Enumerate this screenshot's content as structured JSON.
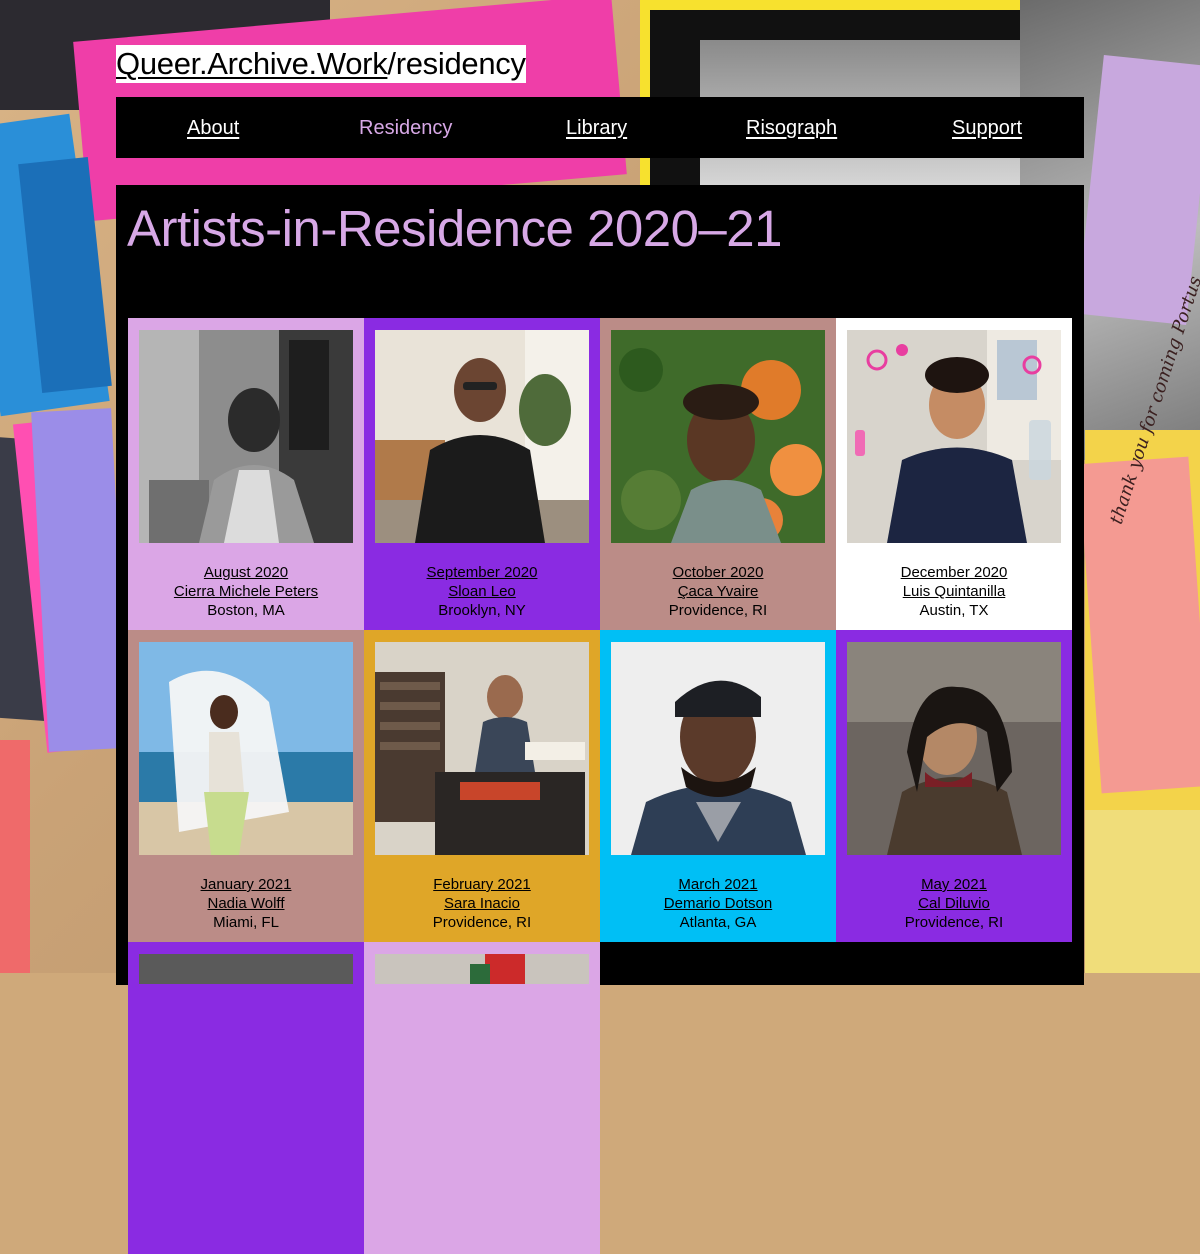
{
  "site": {
    "title_link": "Queer.Archive.Work",
    "title_path": "/residency"
  },
  "nav": {
    "items": [
      {
        "label": "About",
        "active": false
      },
      {
        "label": "Residency",
        "active": true
      },
      {
        "label": "Library",
        "active": false
      },
      {
        "label": "Risograph",
        "active": false
      },
      {
        "label": "Support",
        "active": false
      }
    ]
  },
  "page": {
    "heading": "Artists-in-Residence 2020–21"
  },
  "handwriting": "thank you for coming Portus",
  "residents": [
    {
      "month": "August 2020",
      "name": "Cierra Michele Peters",
      "location": "Boston, MA",
      "color": "#dba6e6"
    },
    {
      "month": "September 2020",
      "name": "Sloan Leo",
      "location": "Brooklyn, NY",
      "color": "#8a2be2"
    },
    {
      "month": "October 2020",
      "name": "Çaca Yvaire",
      "location": "Providence, RI",
      "color": "#bb8c87"
    },
    {
      "month": "December 2020",
      "name": "Luis Quintanilla",
      "location": "Austin, TX",
      "color": "#ffffff"
    },
    {
      "month": "January 2021",
      "name": "Nadia Wolff",
      "location": "Miami, FL",
      "color": "#bb8c87"
    },
    {
      "month": "February 2021",
      "name": "Sara Inacio",
      "location": "Providence, RI",
      "color": "#dfa628"
    },
    {
      "month": "March 2021",
      "name": "Demario Dotson",
      "location": "Atlanta, GA",
      "color": "#00bff5"
    },
    {
      "month": "May 2021",
      "name": "Cal Diluvio",
      "location": "Providence, RI",
      "color": "#8a2be2"
    }
  ]
}
